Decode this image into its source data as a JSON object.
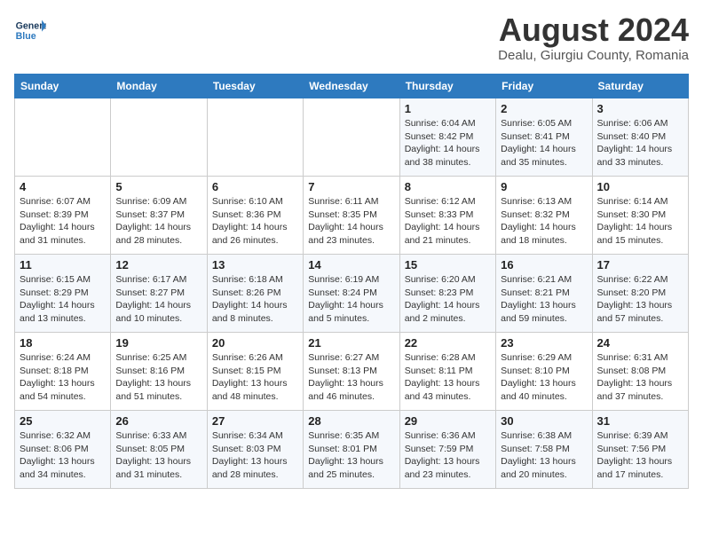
{
  "header": {
    "logo_line1": "General",
    "logo_line2": "Blue",
    "month_year": "August 2024",
    "location": "Dealu, Giurgiu County, Romania"
  },
  "days_of_week": [
    "Sunday",
    "Monday",
    "Tuesday",
    "Wednesday",
    "Thursday",
    "Friday",
    "Saturday"
  ],
  "weeks": [
    [
      {
        "day": "",
        "info": ""
      },
      {
        "day": "",
        "info": ""
      },
      {
        "day": "",
        "info": ""
      },
      {
        "day": "",
        "info": ""
      },
      {
        "day": "1",
        "info": "Sunrise: 6:04 AM\nSunset: 8:42 PM\nDaylight: 14 hours\nand 38 minutes."
      },
      {
        "day": "2",
        "info": "Sunrise: 6:05 AM\nSunset: 8:41 PM\nDaylight: 14 hours\nand 35 minutes."
      },
      {
        "day": "3",
        "info": "Sunrise: 6:06 AM\nSunset: 8:40 PM\nDaylight: 14 hours\nand 33 minutes."
      }
    ],
    [
      {
        "day": "4",
        "info": "Sunrise: 6:07 AM\nSunset: 8:39 PM\nDaylight: 14 hours\nand 31 minutes."
      },
      {
        "day": "5",
        "info": "Sunrise: 6:09 AM\nSunset: 8:37 PM\nDaylight: 14 hours\nand 28 minutes."
      },
      {
        "day": "6",
        "info": "Sunrise: 6:10 AM\nSunset: 8:36 PM\nDaylight: 14 hours\nand 26 minutes."
      },
      {
        "day": "7",
        "info": "Sunrise: 6:11 AM\nSunset: 8:35 PM\nDaylight: 14 hours\nand 23 minutes."
      },
      {
        "day": "8",
        "info": "Sunrise: 6:12 AM\nSunset: 8:33 PM\nDaylight: 14 hours\nand 21 minutes."
      },
      {
        "day": "9",
        "info": "Sunrise: 6:13 AM\nSunset: 8:32 PM\nDaylight: 14 hours\nand 18 minutes."
      },
      {
        "day": "10",
        "info": "Sunrise: 6:14 AM\nSunset: 8:30 PM\nDaylight: 14 hours\nand 15 minutes."
      }
    ],
    [
      {
        "day": "11",
        "info": "Sunrise: 6:15 AM\nSunset: 8:29 PM\nDaylight: 14 hours\nand 13 minutes."
      },
      {
        "day": "12",
        "info": "Sunrise: 6:17 AM\nSunset: 8:27 PM\nDaylight: 14 hours\nand 10 minutes."
      },
      {
        "day": "13",
        "info": "Sunrise: 6:18 AM\nSunset: 8:26 PM\nDaylight: 14 hours\nand 8 minutes."
      },
      {
        "day": "14",
        "info": "Sunrise: 6:19 AM\nSunset: 8:24 PM\nDaylight: 14 hours\nand 5 minutes."
      },
      {
        "day": "15",
        "info": "Sunrise: 6:20 AM\nSunset: 8:23 PM\nDaylight: 14 hours\nand 2 minutes."
      },
      {
        "day": "16",
        "info": "Sunrise: 6:21 AM\nSunset: 8:21 PM\nDaylight: 13 hours\nand 59 minutes."
      },
      {
        "day": "17",
        "info": "Sunrise: 6:22 AM\nSunset: 8:20 PM\nDaylight: 13 hours\nand 57 minutes."
      }
    ],
    [
      {
        "day": "18",
        "info": "Sunrise: 6:24 AM\nSunset: 8:18 PM\nDaylight: 13 hours\nand 54 minutes."
      },
      {
        "day": "19",
        "info": "Sunrise: 6:25 AM\nSunset: 8:16 PM\nDaylight: 13 hours\nand 51 minutes."
      },
      {
        "day": "20",
        "info": "Sunrise: 6:26 AM\nSunset: 8:15 PM\nDaylight: 13 hours\nand 48 minutes."
      },
      {
        "day": "21",
        "info": "Sunrise: 6:27 AM\nSunset: 8:13 PM\nDaylight: 13 hours\nand 46 minutes."
      },
      {
        "day": "22",
        "info": "Sunrise: 6:28 AM\nSunset: 8:11 PM\nDaylight: 13 hours\nand 43 minutes."
      },
      {
        "day": "23",
        "info": "Sunrise: 6:29 AM\nSunset: 8:10 PM\nDaylight: 13 hours\nand 40 minutes."
      },
      {
        "day": "24",
        "info": "Sunrise: 6:31 AM\nSunset: 8:08 PM\nDaylight: 13 hours\nand 37 minutes."
      }
    ],
    [
      {
        "day": "25",
        "info": "Sunrise: 6:32 AM\nSunset: 8:06 PM\nDaylight: 13 hours\nand 34 minutes."
      },
      {
        "day": "26",
        "info": "Sunrise: 6:33 AM\nSunset: 8:05 PM\nDaylight: 13 hours\nand 31 minutes."
      },
      {
        "day": "27",
        "info": "Sunrise: 6:34 AM\nSunset: 8:03 PM\nDaylight: 13 hours\nand 28 minutes."
      },
      {
        "day": "28",
        "info": "Sunrise: 6:35 AM\nSunset: 8:01 PM\nDaylight: 13 hours\nand 25 minutes."
      },
      {
        "day": "29",
        "info": "Sunrise: 6:36 AM\nSunset: 7:59 PM\nDaylight: 13 hours\nand 23 minutes."
      },
      {
        "day": "30",
        "info": "Sunrise: 6:38 AM\nSunset: 7:58 PM\nDaylight: 13 hours\nand 20 minutes."
      },
      {
        "day": "31",
        "info": "Sunrise: 6:39 AM\nSunset: 7:56 PM\nDaylight: 13 hours\nand 17 minutes."
      }
    ]
  ]
}
